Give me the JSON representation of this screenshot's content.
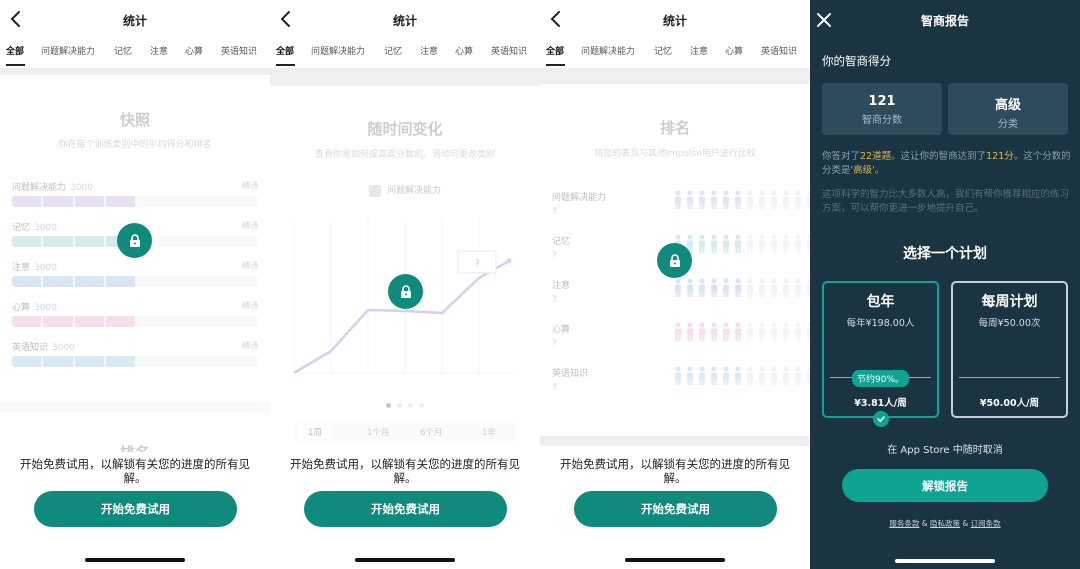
{
  "common": {
    "title": "统计",
    "tabs": [
      "全部",
      "问题解决能力",
      "记忆",
      "注意",
      "心算",
      "英语知识"
    ],
    "bottom_text": "开始免费试用，以解锁有关您的进度的所有见解。",
    "cta_label": "开始免费试用"
  },
  "snapshot": {
    "title": "快照",
    "subtitle": "你在每个训练类别中的平均得分和排名",
    "right_label": "精通",
    "categories": [
      {
        "label": "问题解决能力",
        "score": "3000",
        "fill": 0.5,
        "color": "#b9a4d8"
      },
      {
        "label": "记忆",
        "score": "3000",
        "fill": 0.5,
        "color": "#7fc3c6"
      },
      {
        "label": "注意",
        "score": "3000",
        "fill": 0.5,
        "color": "#90aed8"
      },
      {
        "label": "心算",
        "score": "3000",
        "fill": 0.5,
        "color": "#e49bc9"
      },
      {
        "label": "英语知识",
        "score": "3000",
        "fill": 0.5,
        "color": "#8fbfe0"
      }
    ],
    "next_section": "排名"
  },
  "trend": {
    "title": "随时间变化",
    "subtitle": "查看你是如何提高高分数的。滑动可更改类别",
    "chip": "问题解决能力",
    "tooltip": "?",
    "ranges": [
      "1周",
      "1个月",
      "6个月",
      "1年"
    ],
    "selected_range": "1周"
  },
  "ranking": {
    "title": "排名",
    "subtitle": "将您的表现与其他Impulse用户进行比较",
    "unknown": "?",
    "rows": [
      {
        "label": "问题解决能力",
        "color": "#b9a4d8"
      },
      {
        "label": "记忆",
        "color": "#7fc3c6"
      },
      {
        "label": "注意",
        "color": "#90aed8"
      },
      {
        "label": "心算",
        "color": "#e49bc9"
      },
      {
        "label": "英语知识",
        "color": "#8fbfe0"
      }
    ]
  },
  "report": {
    "title": "智商报告",
    "score_label": "你的智商得分",
    "score_value": "121",
    "score_caption": "智商分数",
    "class_value": "高级",
    "class_caption": "分类",
    "para_a": "你答对了",
    "para_correct": "22道题",
    "para_b": "。这让你的智商达到了",
    "para_iq": "121分",
    "para_c": "。这个分数的分类是",
    "para_class": "'高级'",
    "para_d": "。",
    "para2": "这项科学的智力比大多数人高，我们有帮你推荐相应的练习方案，可以帮你更进一步地提升自己。",
    "choose_title": "选择一个计划",
    "plan_year": {
      "name": "包年",
      "price": "每年¥198.00人",
      "badge": "节约90%。",
      "weekly": "¥3.81人/周"
    },
    "plan_week": {
      "name": "每周计划",
      "price": "每周¥50.00次",
      "weekly": "¥50.00人/周"
    },
    "cancel_note": "在 App Store 中随时取消",
    "unlock_label": "解锁报告",
    "legal": {
      "terms": "服务条款",
      "privacy": "隐私政策",
      "subscription": "订阅条款",
      "sep": " & "
    }
  }
}
